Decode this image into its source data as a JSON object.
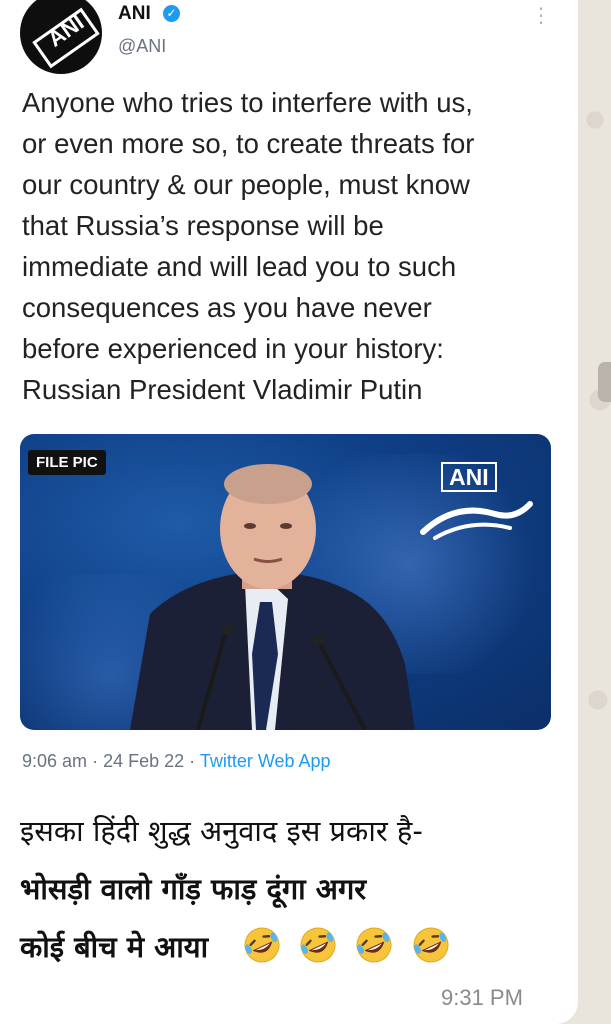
{
  "tweet": {
    "account_name": "ANI",
    "handle": "@ANI",
    "avatar_text": "ANI",
    "text_lines": [
      "Anyone who tries to interfere with us,",
      "or even more so, to create threats for",
      "our country & our people, must know",
      "that Russia’s response will be",
      "immediate and will lead you to such",
      "consequences as you have never",
      "before experienced in your history:",
      "Russian President Vladimir Putin"
    ],
    "image_label": "FILE PIC",
    "image_watermark": "ANI",
    "time": "9:06 am",
    "date": "24 Feb 22",
    "source": "Twitter Web App"
  },
  "message": {
    "caption_lines": [
      "इसका हिंदी शुद्ध अनुवाद इस प्रकार है-",
      "भोसड़ी वालो गाँड़ फाड़ दूंगा अगर",
      "कोई बीच मे आया"
    ],
    "emoji": [
      "rolling-on-floor-laughing",
      "rolling-on-floor-laughing",
      "rolling-on-floor-laughing",
      "rolling-on-floor-laughing"
    ],
    "timestamp": "9:31 PM"
  },
  "colors": {
    "verified": "#1d9bf0",
    "link": "#1d9bf0",
    "bubble": "#ffffff",
    "wallpaper": "#e9e4dc"
  }
}
